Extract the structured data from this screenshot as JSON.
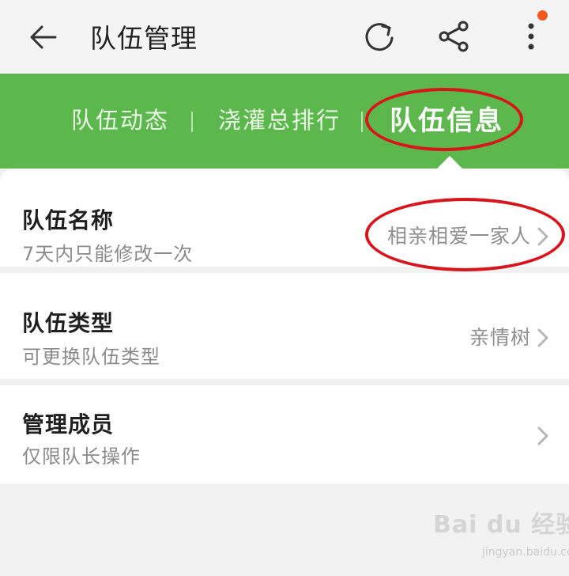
{
  "colors": {
    "green": "#5cb74c",
    "annotation_red": "#d9141b",
    "badge_orange": "#f25a1d"
  },
  "header": {
    "title": "队伍管理",
    "icons": [
      "back-arrow-icon",
      "refresh-icon",
      "share-icon",
      "more-vertical-icon"
    ]
  },
  "tabs": [
    {
      "label": "队伍动态",
      "active": false
    },
    {
      "label": "浇灌总排行",
      "active": false
    },
    {
      "label": "队伍信息",
      "active": true
    }
  ],
  "rows": [
    {
      "label": "队伍名称",
      "sub": "7天内只能修改一次",
      "value": "相亲相爱一家人"
    },
    {
      "label": "队伍类型",
      "sub": "可更换队伍类型",
      "value": "亲情树"
    },
    {
      "label": "管理成员",
      "sub": "仅限队长操作",
      "value": ""
    }
  ],
  "watermark": {
    "brand": "Bai du 经验",
    "sub": "jingyan.baidu.com"
  }
}
